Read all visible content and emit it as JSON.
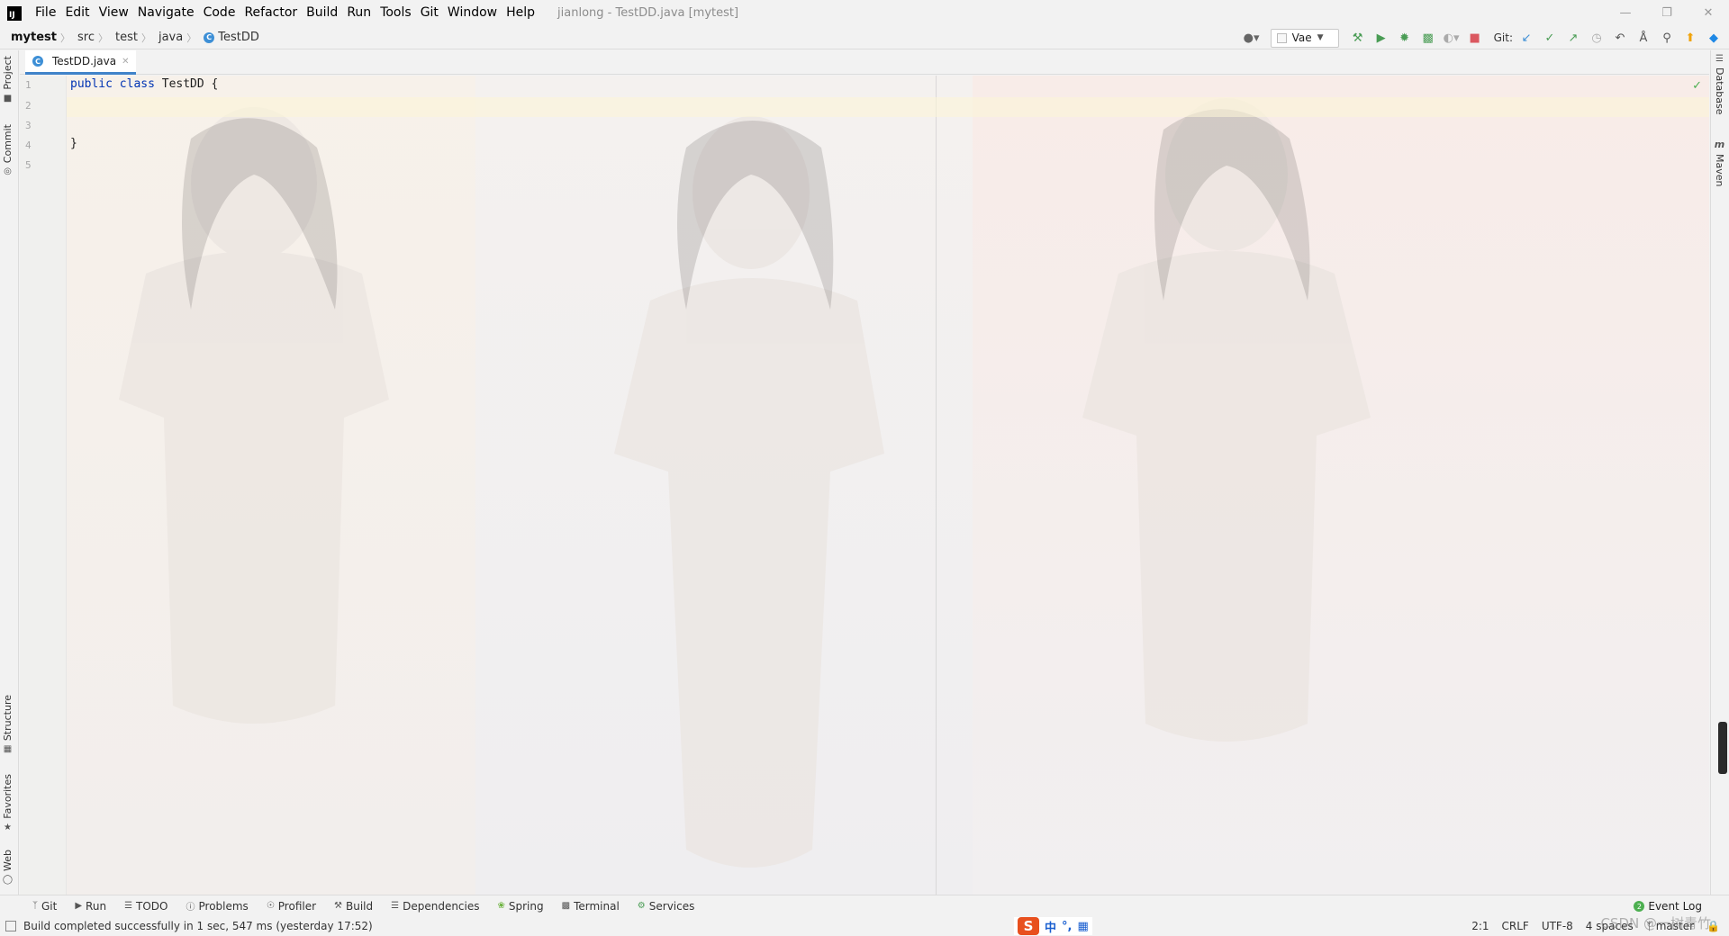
{
  "window": {
    "logo_text": "IJ",
    "title": "jianlong - TestDD.java [mytest]",
    "controls": [
      "—",
      "❐",
      "✕"
    ]
  },
  "menu": [
    "File",
    "Edit",
    "View",
    "Navigate",
    "Code",
    "Refactor",
    "Build",
    "Run",
    "Tools",
    "Git",
    "Window",
    "Help"
  ],
  "breadcrumb": [
    "mytest",
    "src",
    "test",
    "java",
    "TestDD"
  ],
  "class_badge": "C",
  "toolbar": {
    "run_config": "Vae",
    "git_label": "Git:"
  },
  "left_tools": {
    "top": [
      "Project",
      "Commit"
    ],
    "bottom": [
      "Structure",
      "Favorites",
      "Web"
    ]
  },
  "right_tools": [
    "Database",
    "Maven"
  ],
  "editor": {
    "tab_label": "TestDD.java",
    "lines": [
      {
        "num": "1",
        "keywords": "public class",
        "rest": " TestDD {"
      },
      {
        "num": "2",
        "keywords": "",
        "rest": ""
      },
      {
        "num": "3",
        "keywords": "",
        "rest": ""
      },
      {
        "num": "4",
        "keywords": "",
        "rest": "}"
      },
      {
        "num": "5",
        "keywords": "",
        "rest": ""
      }
    ]
  },
  "bottom_tools": [
    "Git",
    "Run",
    "TODO",
    "Problems",
    "Profiler",
    "Build",
    "Dependencies",
    "Spring",
    "Terminal",
    "Services"
  ],
  "event_log": {
    "count": "2",
    "label": "Event Log"
  },
  "status": {
    "message": "Build completed successfully in 1 sec, 547 ms (yesterday 17:52)",
    "position": "2:1",
    "line_sep": "CRLF",
    "encoding": "UTF-8",
    "indent": "4 spaces",
    "branch": "master"
  },
  "ime": {
    "logo": "S",
    "lang": "中",
    "punct": "°,"
  },
  "watermark": "CSDN @一树青竹",
  "colors": {
    "accent": "#4083c9",
    "keyword": "#0033b3",
    "run_green": "#499c54",
    "stop_red": "#db5860"
  }
}
